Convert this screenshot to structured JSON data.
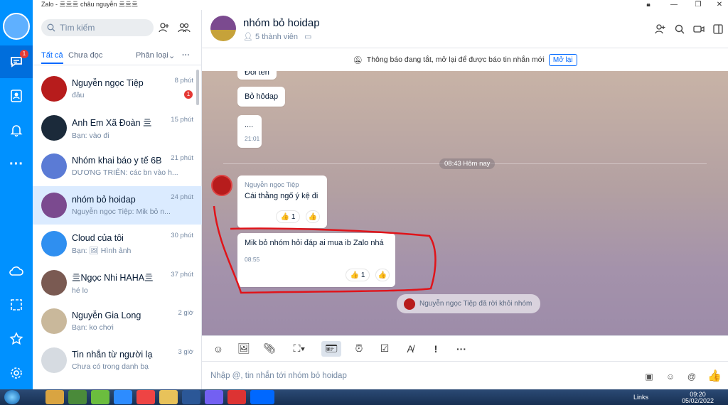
{
  "window": {
    "title": "Zalo - 亖亖亖 châu nguyễn 亖亖亖"
  },
  "rail": {
    "messages_badge": "1"
  },
  "sidebar": {
    "search_placeholder": "Tìm kiếm",
    "tabs": {
      "all": "Tất cả",
      "unread": "Chưa đọc",
      "classify": "Phân loại"
    },
    "conversations": [
      {
        "name": "Nguyễn ngọc Tiệp",
        "preview": "đâu",
        "time": "8 phút",
        "unread": "1",
        "avatar_color": "#b71c1c"
      },
      {
        "name": "Anh Em Xã Đoàn 亖",
        "preview": "Bạn: vào đi",
        "time": "15 phút",
        "avatar_color": "#1b2a3a"
      },
      {
        "name": "Nhóm khai báo y tế 6B",
        "preview": "DƯƠNG TRIỂN: các bn vào h...",
        "time": "21 phút",
        "avatar_color": "#5b7bd5"
      },
      {
        "name": "nhóm bỏ hoidap",
        "preview": "Nguyễn ngọc Tiệp: Mik bỏ n...",
        "time": "24 phút",
        "avatar_color": "#7b4a8f"
      },
      {
        "name": "Cloud của tôi",
        "preview": "Bạn: 🖼 Hình ảnh",
        "time": "30 phút",
        "avatar_color": "#2f8ff0"
      },
      {
        "name": "亖Ngọc Nhi HAHA亖",
        "preview": "hé lo",
        "time": "37 phút",
        "avatar_color": "#7a5a52"
      },
      {
        "name": "Nguyễn Gia Long",
        "preview": "Bạn: ko chơi",
        "time": "2 giờ",
        "avatar_color": "#c9b89b"
      },
      {
        "name": "Tin nhắn từ người lạ",
        "preview": "Chưa có trong danh bạ",
        "time": "3 giờ",
        "avatar_color": "#d6dbe1"
      }
    ]
  },
  "header": {
    "group_name": "nhóm bỏ hoidap",
    "members": "5 thành viên"
  },
  "notice": {
    "text": "Thông báo đang tắt, mở lại để được báo tin nhắn mới",
    "button": "Mở lại"
  },
  "messages": {
    "partial_top": "Đổi tên",
    "m1": "Bỏ hôdap",
    "m2": "....",
    "m2_time": "21:01",
    "divider": "08:43 Hôm nay",
    "sender": "Nguyễn ngọc Tiệp",
    "m3": "Cái thằng ngố ý kệ đi",
    "m3_reacts": "👍 1",
    "m4": "Mik bỏ nhóm hỏi đáp ai mua ib Zalo nhá",
    "m4_time": "08:55",
    "m4_reacts": "👍 1",
    "system": "Nguyễn ngọc Tiệp đã rời khỏi nhóm"
  },
  "composer": {
    "placeholder": "Nhập @, tin nhắn tới nhóm bỏ hoidap"
  },
  "taskbar": {
    "links": "Links",
    "time": "09:20",
    "date": "05/02/2022"
  }
}
